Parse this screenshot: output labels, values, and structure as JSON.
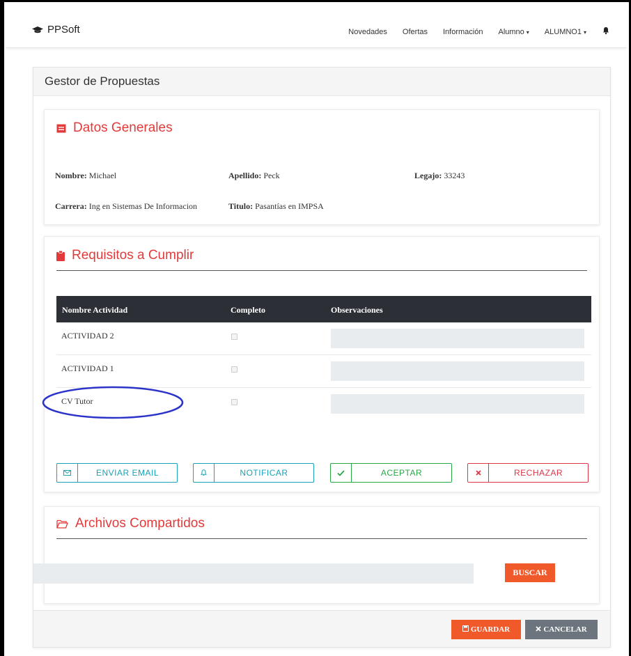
{
  "navbar": {
    "brand": "PPSoft",
    "links": [
      "Novedades",
      "Ofertas",
      "Información",
      "Alumno",
      "ALUMNO1"
    ]
  },
  "card": {
    "header": "Gestor de Propuestas"
  },
  "datos_generales": {
    "title": "Datos Generales",
    "nombre_label": "Nombre:",
    "nombre_value": "Michael",
    "apellido_label": "Apellido:",
    "apellido_value": "Peck",
    "legajo_label": "Legajo:",
    "legajo_value": "33243",
    "carrera_label": "Carrera:",
    "carrera_value": "Ing en Sistemas De Informacion",
    "titulo_label": "Titulo:",
    "titulo_value": "Pasantías en IMPSA"
  },
  "requisitos": {
    "title": "Requisitos a Cumplir",
    "columns": [
      "Nombre Actividad",
      "Completo",
      "Observaciones"
    ],
    "rows": [
      {
        "name": "ACTIVIDAD 2",
        "completo": false,
        "observaciones": ""
      },
      {
        "name": "ACTIVIDAD 1",
        "completo": false,
        "observaciones": ""
      },
      {
        "name": "CV Tutor",
        "completo": false,
        "observaciones": ""
      }
    ],
    "buttons": {
      "email": "ENVIAR EMAIL",
      "notificar": "NOTIFICAR",
      "aceptar": "ACEPTAR",
      "rechazar": "RECHAZAR"
    }
  },
  "archivos": {
    "title": "Archivos Compartidos",
    "buscar": "BUSCAR"
  },
  "footer": {
    "guardar": "GUARDAR",
    "cancelar": "CANCELAR"
  },
  "colors": {
    "accent": "#e23a3a",
    "orange": "#f05a2b",
    "table_header": "#2c3036",
    "info": "#17a2b8",
    "success": "#28a745",
    "danger": "#dc3545",
    "highlight_ellipse": "#2b33c9"
  }
}
